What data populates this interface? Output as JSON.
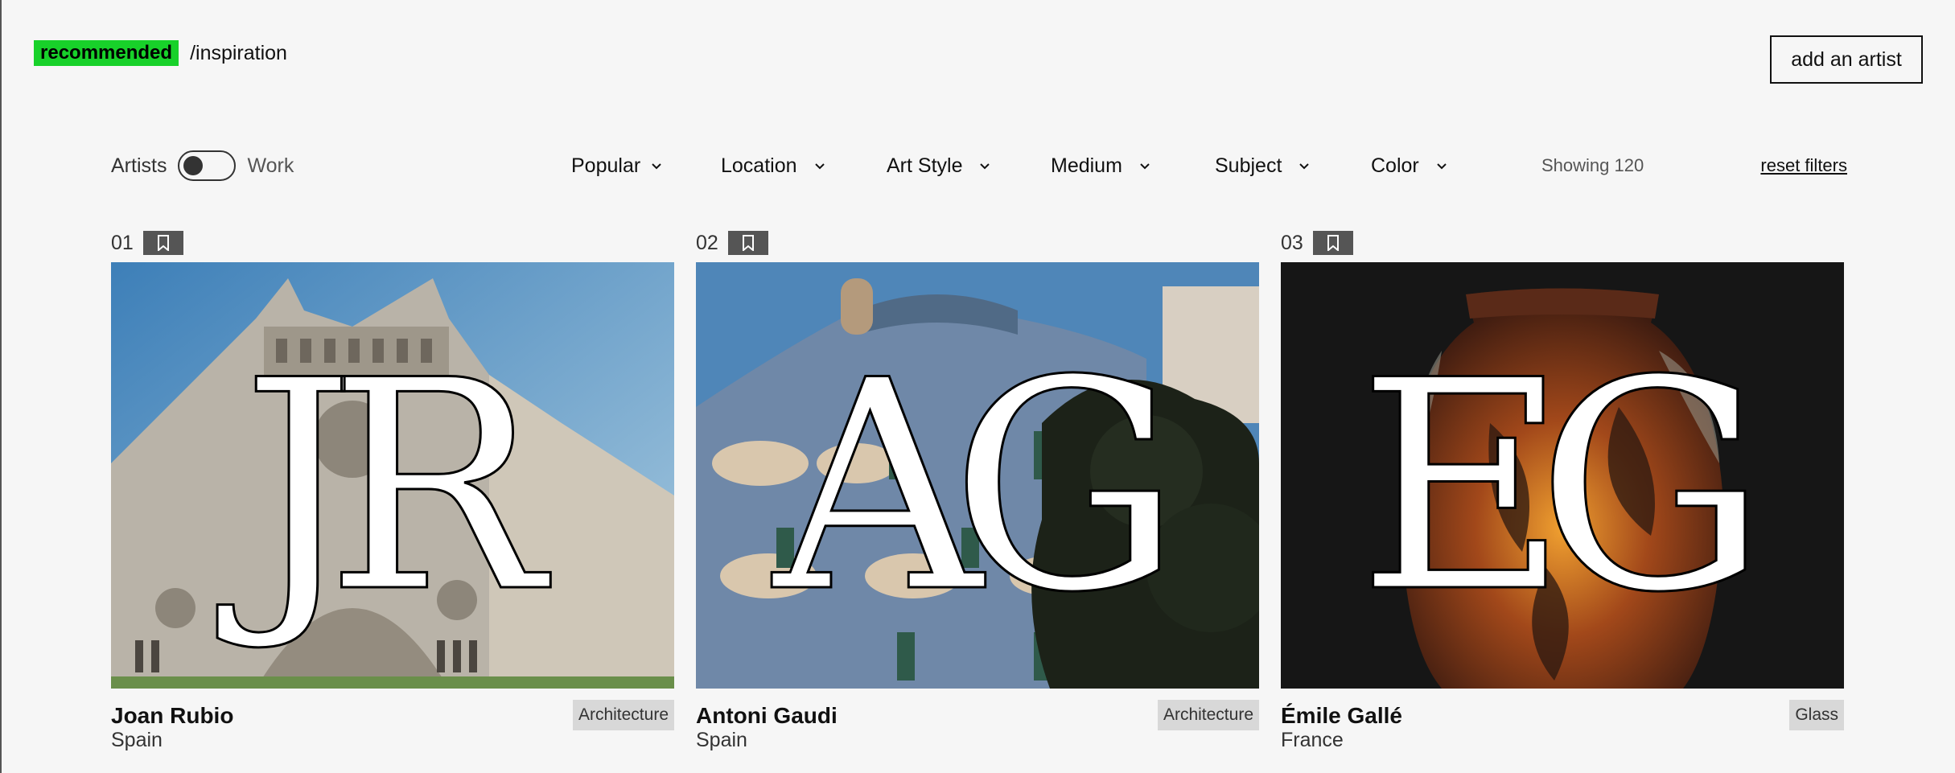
{
  "brand": {
    "tag": "recommended",
    "path": "/inspiration"
  },
  "header": {
    "add_artist_label": "add an artist"
  },
  "filters": {
    "toggle_left": "Artists",
    "toggle_right": "Work",
    "items": [
      {
        "label": "Popular"
      },
      {
        "label": "Location"
      },
      {
        "label": "Art Style"
      },
      {
        "label": "Medium"
      },
      {
        "label": "Subject"
      },
      {
        "label": "Color"
      }
    ],
    "showing": "Showing 120",
    "reset": "reset filters"
  },
  "cards": [
    {
      "num": "01",
      "monogram": "JR",
      "name": "Joan Rubio",
      "location": "Spain",
      "category": "Architecture",
      "image": "gothic-church-facade"
    },
    {
      "num": "02",
      "monogram": "AG",
      "name": "Antoni Gaudi",
      "location": "Spain",
      "category": "Architecture",
      "image": "casa-batllo-facade"
    },
    {
      "num": "03",
      "monogram": "EG",
      "name": "Émile Gallé",
      "location": "France",
      "category": "Glass",
      "image": "art-nouveau-glass-vase"
    }
  ],
  "colors": {
    "accent": "#18d12a",
    "badge_bg": "#d8d8d8",
    "bookmark_bg": "#555555"
  }
}
